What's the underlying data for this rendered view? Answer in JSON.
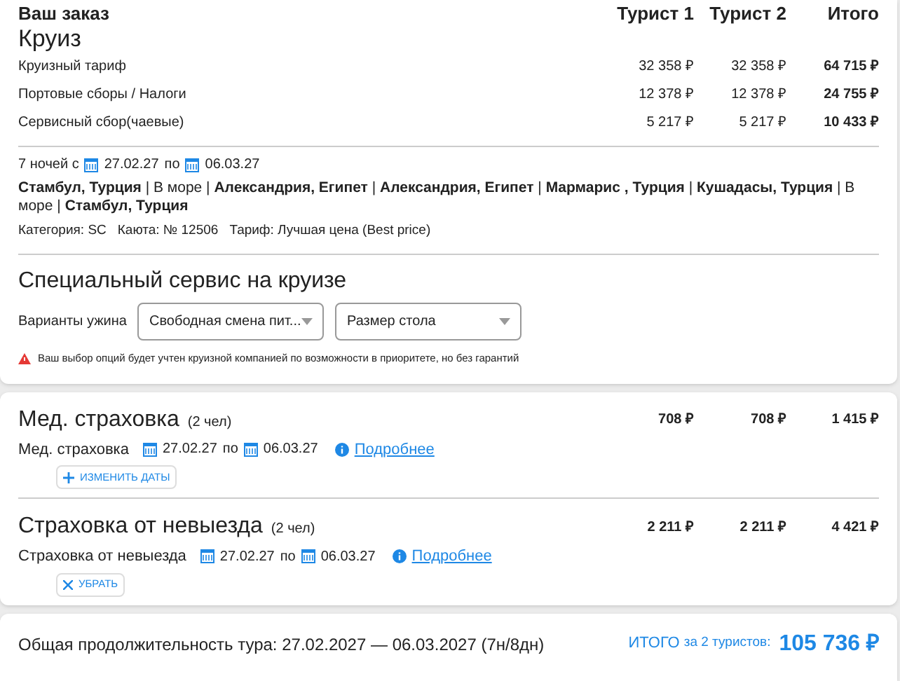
{
  "order": {
    "heading": "Ваш заказ",
    "title": "Круиз",
    "columns": [
      "Турист 1",
      "Турист 2",
      "Итого"
    ],
    "rows": [
      {
        "label": "Круизный тариф",
        "values": [
          "32 358 ₽",
          "32 358 ₽",
          "64 715 ₽"
        ]
      },
      {
        "label": "Портовые сборы / Налоги",
        "values": [
          "12 378 ₽",
          "12 378 ₽",
          "24 755 ₽"
        ]
      },
      {
        "label": "Сервисный сбор(чаевые)",
        "values": [
          "5 217 ₽",
          "5 217 ₽",
          "10 433 ₽"
        ]
      }
    ],
    "dates": {
      "prefix": "7 ночей с",
      "from": "27.02.27",
      "between": "по",
      "to": "06.03.27"
    },
    "route": "**Стамбул, Турция** | В море | **Александрия, Египет** | **Александрия, Египет** | **Мармарис , Турция** | **Кушадасы, Турция** | В море | **Стамбул, Турция**",
    "details": [
      "Категория: SC",
      "Каюта: № 12506",
      "Тариф: Лучшая цена (Best price)"
    ]
  },
  "service": {
    "title": "Специальный сервис на круизе",
    "label": "Варианты ужина",
    "selects": [
      {
        "value": "Свободная смена пит..."
      },
      {
        "value": "Размер стола"
      }
    ],
    "warning": "Ваш выбор опций будет учтен круизной компанией по возможности в приоритете, но без гарантий"
  },
  "insurances": [
    {
      "title": "Мед. страховка",
      "count": "(2 чел)",
      "values": [
        "708 ₽",
        "708 ₽",
        "1 415 ₽"
      ],
      "label": "Мед. страховка",
      "from": "27.02.27",
      "between": "по",
      "to": "06.03.27",
      "link": "Подробнее",
      "action": {
        "kind": "add",
        "label": "ИЗМЕНИТЬ ДАТЫ"
      }
    },
    {
      "title": "Страховка от невыезда",
      "count": "(2 чел)",
      "values": [
        "2 211 ₽",
        "2 211 ₽",
        "4 421 ₽"
      ],
      "label": "Страховка от невыезда",
      "from": "27.02.27",
      "between": "по",
      "to": "06.03.27",
      "link": "Подробнее",
      "action": {
        "kind": "remove",
        "label": "УБРАТЬ"
      }
    }
  ],
  "footer": {
    "duration": "Общая продолжительность тура: 27.02.2027 — 06.03.2027 (7н/8дн)",
    "total_label": "ИТОГО",
    "total_suffix": "за 2 туристов:",
    "total": "105 736 ₽"
  }
}
